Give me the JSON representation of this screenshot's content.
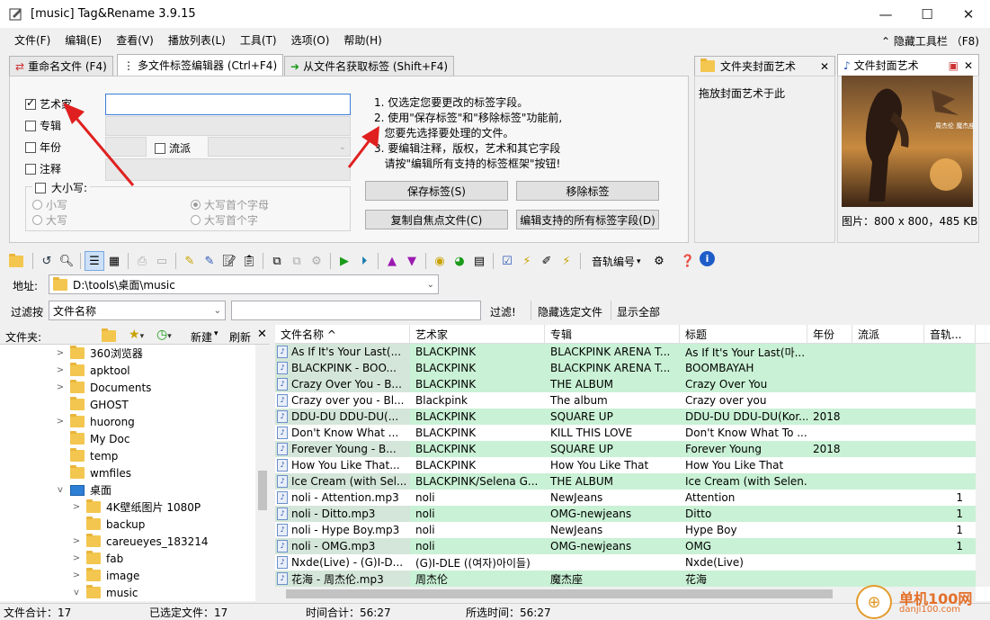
{
  "window": {
    "title": "[music] Tag&Rename 3.9.15",
    "minimize": "—",
    "maximize": "☐",
    "close": "✕"
  },
  "menu": {
    "items": [
      "文件(F)",
      "编辑(E)",
      "查看(V)",
      "播放列表(L)",
      "工具(T)",
      "选项(O)",
      "帮助(H)"
    ],
    "hide_toolbar": "隐藏工具栏 （F8)"
  },
  "tabs": [
    "重命名文件 (F4)",
    "多文件标签编辑器 (Ctrl+F4)",
    "从文件名获取标签 (Shift+F4)"
  ],
  "editor": {
    "fields": [
      {
        "label": "艺术家",
        "checked": true
      },
      {
        "label": "专辑",
        "checked": false
      },
      {
        "label": "年份",
        "checked": false
      },
      {
        "label": "注释",
        "checked": false
      }
    ],
    "genre_label": "流派",
    "case_label": "大小写:",
    "case_options": [
      "小写",
      "大写",
      "大写首个字母",
      "大写首个字"
    ],
    "instructions": [
      "1. 仅选定您要更改的标签字段。",
      "2. 使用\"保存标签\"和\"移除标签\"功能前,",
      "   您要先选择要处理的文件。",
      "3. 要编辑注释，版权，艺术和其它字段",
      "   请按\"编辑所有支持的标签框架\"按钮!"
    ],
    "buttons": {
      "save": "保存标签(S)",
      "remove": "移除标签",
      "copy": "复制自焦点文件(C)",
      "edit_all": "编辑支持的所有标签字段(D)"
    }
  },
  "cover": {
    "folder_tab": "文件夹封面艺术",
    "file_tab": "文件封面艺术",
    "drop_hint": "拖放封面艺术于此",
    "info": "图片：800 x 800，485 KB",
    "art_caption": "周杰伦 魔杰座"
  },
  "toolbar": {
    "track_number": "音轨编号"
  },
  "address": {
    "label": "地址:",
    "value": "D:\\tools\\桌面\\music"
  },
  "filter": {
    "label": "过滤按",
    "field": "文件名称",
    "value": "",
    "apply": "过滤!",
    "hide_selected": "隐藏选定文件",
    "show_all": "显示全部"
  },
  "folders_panel": {
    "label": "文件夹:",
    "new": "新建",
    "refresh": "刷新"
  },
  "tree": [
    {
      "name": "360浏览器",
      "indent": 3,
      "exp": ">"
    },
    {
      "name": "apktool",
      "indent": 3,
      "exp": ">"
    },
    {
      "name": "Documents",
      "indent": 3,
      "exp": ">"
    },
    {
      "name": "GHOST",
      "indent": 3,
      "exp": ""
    },
    {
      "name": "huorong",
      "indent": 3,
      "exp": ">"
    },
    {
      "name": "My Doc",
      "indent": 3,
      "exp": ""
    },
    {
      "name": "temp",
      "indent": 3,
      "exp": ""
    },
    {
      "name": "wmfiles",
      "indent": 3,
      "exp": ""
    },
    {
      "name": "桌面",
      "indent": 3,
      "exp": "v",
      "desktop": true
    },
    {
      "name": "4K壁纸图片 1080P",
      "indent": 4,
      "exp": ">"
    },
    {
      "name": "backup",
      "indent": 4,
      "exp": ""
    },
    {
      "name": "careueyes_183214",
      "indent": 4,
      "exp": ">"
    },
    {
      "name": "fab",
      "indent": 4,
      "exp": ">"
    },
    {
      "name": "image",
      "indent": 4,
      "exp": ">"
    },
    {
      "name": "music",
      "indent": 4,
      "exp": "v"
    }
  ],
  "columns": [
    "文件名称 ^",
    "艺术家",
    "专辑",
    "标题",
    "年份",
    "流派",
    "音轨..."
  ],
  "files": [
    {
      "name": "As If It's Your Last(...",
      "artist": "BLACKPINK",
      "album": "BLACKPINK ARENA T...",
      "title": "As If It's Your Last(마...",
      "year": "",
      "genre": "",
      "track": "",
      "hl": true
    },
    {
      "name": "BLACKPINK - BOO...",
      "artist": "BLACKPINK",
      "album": "BLACKPINK ARENA T...",
      "title": "BOOMBAYAH",
      "year": "",
      "genre": "",
      "track": "",
      "hl": true
    },
    {
      "name": "Crazy Over You - B...",
      "artist": "BLACKPINK",
      "album": "THE ALBUM",
      "title": "Crazy Over You",
      "year": "",
      "genre": "",
      "track": "",
      "hl": true
    },
    {
      "name": "Crazy over you - Bl...",
      "artist": "Blackpink",
      "album": "The album",
      "title": "Crazy over you",
      "year": "",
      "genre": "",
      "track": "",
      "hl": false
    },
    {
      "name": "DDU-DU DDU-DU(...",
      "artist": "BLACKPINK",
      "album": "SQUARE UP",
      "title": "DDU-DU DDU-DU(Kor...",
      "year": "2018",
      "genre": "",
      "track": "",
      "hl": true
    },
    {
      "name": "Don't Know What ...",
      "artist": "BLACKPINK",
      "album": "KILL THIS LOVE",
      "title": "Don't Know What To ...",
      "year": "",
      "genre": "",
      "track": "",
      "hl": false
    },
    {
      "name": "Forever Young - B...",
      "artist": "BLACKPINK",
      "album": "SQUARE UP",
      "title": "Forever Young",
      "year": "2018",
      "genre": "",
      "track": "",
      "hl": true
    },
    {
      "name": "How You Like That...",
      "artist": "BLACKPINK",
      "album": "How You Like That",
      "title": "How You Like That",
      "year": "",
      "genre": "",
      "track": "",
      "hl": false
    },
    {
      "name": "Ice Cream (with Sel...",
      "artist": "BLACKPINK/Selena G...",
      "album": "THE ALBUM",
      "title": "Ice Cream (with Selen...",
      "year": "",
      "genre": "",
      "track": "",
      "hl": true
    },
    {
      "name": "noli - Attention.mp3",
      "artist": "noli",
      "album": "NewJeans",
      "title": "Attention",
      "year": "",
      "genre": "",
      "track": "1",
      "hl": false
    },
    {
      "name": "noli - Ditto.mp3",
      "artist": "noli",
      "album": "OMG-newjeans",
      "title": "Ditto",
      "year": "",
      "genre": "",
      "track": "1",
      "hl": true
    },
    {
      "name": "noli - Hype Boy.mp3",
      "artist": "noli",
      "album": "NewJeans",
      "title": "Hype Boy",
      "year": "",
      "genre": "",
      "track": "1",
      "hl": false
    },
    {
      "name": "noli - OMG.mp3",
      "artist": "noli",
      "album": "OMG-newjeans",
      "title": "OMG",
      "year": "",
      "genre": "",
      "track": "1",
      "hl": true
    },
    {
      "name": "Nxde(Live) - (G)I-D...",
      "artist": "(G)I-DLE ((여자)아이들)",
      "album": "",
      "title": "Nxde(Live)",
      "year": "",
      "genre": "",
      "track": "",
      "hl": false
    },
    {
      "name": "花海 - 周杰伦.mp3",
      "artist": "周杰伦",
      "album": "魔杰座",
      "title": "花海",
      "year": "",
      "genre": "",
      "track": "",
      "hl": true
    }
  ],
  "status": {
    "total_files": "文件合计：17",
    "selected_files": "已选定文件：17",
    "total_time": "时间合计：56:27",
    "selected_time": "所选时间：56:27"
  },
  "watermark": {
    "text": "单机100网",
    "url": "danji100.com"
  }
}
